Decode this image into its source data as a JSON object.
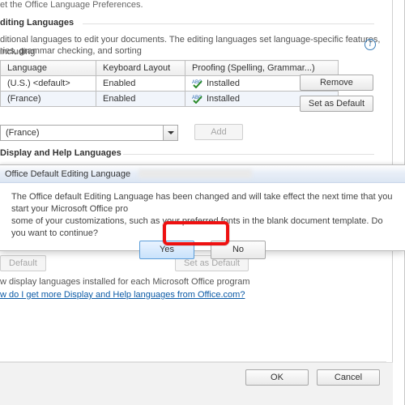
{
  "pref_intro": "et the Office Language Preferences.",
  "editing": {
    "title": "diting Languages",
    "desc1": "ditional languages to edit your documents. The editing languages set language-specific features, including",
    "desc2": "ries, grammar checking, and sorting",
    "headers": {
      "lang": "Language",
      "layout": "Keyboard Layout",
      "proof": "Proofing (Spelling, Grammar...)"
    },
    "rows": [
      {
        "lang": "(U.S.) <default>",
        "layout": "Enabled",
        "proof": "Installed"
      },
      {
        "lang": "(France)",
        "layout": "Enabled",
        "proof": "Installed"
      }
    ],
    "remove": "Remove",
    "set_default": "Set as Default",
    "add_dd": "(France)",
    "add_btn": "Add"
  },
  "display": {
    "title": "Display and Help Languages",
    "default_btn": "Default",
    "setdef_btn": "Set as Default",
    "line": "w display languages installed for each Microsoft Office program",
    "link": "w do I get more Display and Help languages from Office.com?"
  },
  "alert": {
    "title": "Office Default Editing Language",
    "msg1": "The Office default Editing Language has been changed and will take effect the next time that you start your Microsoft Office pro",
    "msg2": "some of your customizations, such as your preferred fonts in the blank document template. Do you want to continue?",
    "yes": "Yes",
    "no": "No"
  },
  "bottom": {
    "ok": "OK",
    "cancel": "Cancel"
  }
}
